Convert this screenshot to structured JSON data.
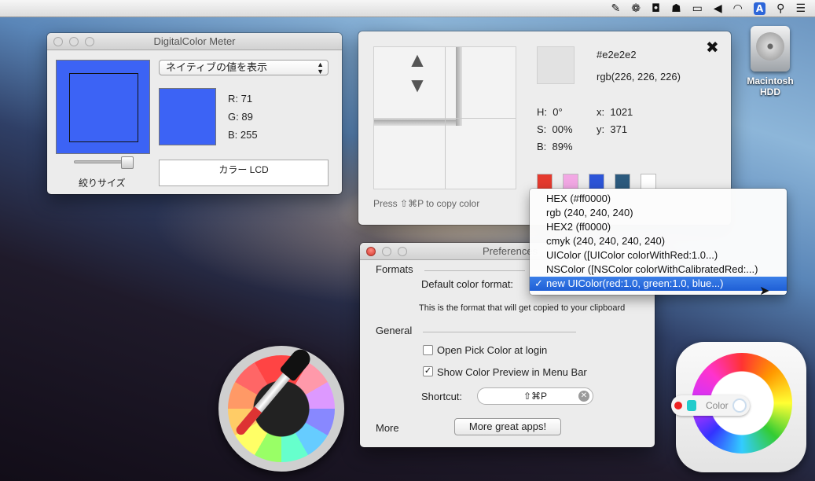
{
  "menubar": {
    "icons": [
      "eyedropper-icon",
      "paw-icon",
      "camera-icon",
      "hat-icon",
      "battery-icon",
      "volume-icon",
      "wifi-icon",
      "input-source-icon",
      "search-icon",
      "list-icon"
    ],
    "input_badge": "A"
  },
  "dcm": {
    "title": "DigitalColor Meter",
    "mode_popup": "ネイティブの値を表示",
    "r_label": "R:",
    "r_value": "71",
    "g_label": "G:",
    "g_value": "89",
    "b_label": "B:",
    "b_value": "255",
    "aperture_label": "絞りサイズ",
    "display_profile": "カラー LCD",
    "color": "#3c63f5"
  },
  "pick": {
    "hex": "#e2e2e2",
    "rgb": "rgb(226, 226, 226)",
    "h_label": "H:",
    "h_value": "0°",
    "s_label": "S:",
    "s_value": "00%",
    "b_label": "B:",
    "b_value": "89%",
    "x_label": "x:",
    "x_value": "1021",
    "y_label": "y:",
    "y_value": "371",
    "hint": "Press ⇧⌘P to copy color",
    "history_colors": [
      "#e53a2e",
      "#f2a8e4",
      "#2d55d8",
      "#2c5a7e",
      "#ffffff"
    ],
    "preview_color": "#e2e2e2"
  },
  "format_menu": {
    "items": [
      "HEX (#ff0000)",
      "rgb (240, 240, 240)",
      "HEX2 (ff0000)",
      "cmyk (240, 240, 240, 240)",
      "UIColor ([UIColor colorWithRed:1.0...)",
      "NSColor ([NSColor colorWithCalibratedRed:...)",
      "new UIColor(red:1.0, green:1.0, blue...)"
    ],
    "selected_index": 6,
    "check": "✓"
  },
  "prefs": {
    "title": "Preferences",
    "formats_heading": "Formats",
    "default_format_label": "Default color format:",
    "format_note": "This is the format that will get copied to your clipboard",
    "general_heading": "General",
    "open_at_login_label": "Open Pick Color at login",
    "open_at_login_checked": false,
    "show_preview_label": "Show Color Preview in Menu Bar",
    "show_preview_checked": true,
    "shortcut_label": "Shortcut:",
    "shortcut_value": "⇧⌘P",
    "more_heading": "More",
    "more_button": "More great apps!"
  },
  "desktop": {
    "hdd_name": "Macintosh HDD",
    "pick_color_label": "Color"
  }
}
